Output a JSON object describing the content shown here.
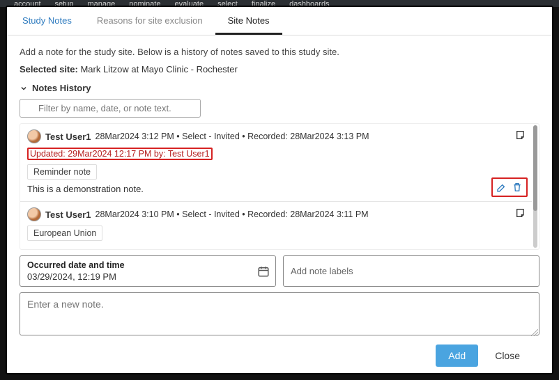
{
  "topnav": [
    "account",
    "setup",
    "manage",
    "nominate",
    "evaluate",
    "select",
    "finalize",
    "dashboards"
  ],
  "tabs": {
    "study_notes": "Study Notes",
    "reasons": "Reasons for site exclusion",
    "site_notes": "Site Notes"
  },
  "helper_text": "Add a note for the study site. Below is a history of notes saved to this study site.",
  "selected_label": "Selected site:",
  "selected_value": "Mark Litzow at Mayo Clinic - Rochester",
  "history_header": "Notes History",
  "filter_placeholder": "Filter by name, date, or note text.",
  "notes": [
    {
      "author": "Test User1",
      "meta": "28Mar2024 3:12 PM • Select - Invited • Recorded: 28Mar2024 3:13 PM",
      "updated": "Updated: 29Mar2024 12:17 PM by: Test User1",
      "label": "Reminder note",
      "body": "This is a demonstration note."
    },
    {
      "author": "Test User1",
      "meta": "28Mar2024 3:10 PM • Select - Invited • Recorded: 28Mar2024 3:11 PM",
      "label": "European Union"
    }
  ],
  "form": {
    "occurred_label": "Occurred date and time",
    "occurred_value": "03/29/2024, 12:19 PM",
    "labels_placeholder": "Add note labels",
    "textarea_placeholder": "Enter a new note."
  },
  "buttons": {
    "add": "Add",
    "close": "Close"
  }
}
